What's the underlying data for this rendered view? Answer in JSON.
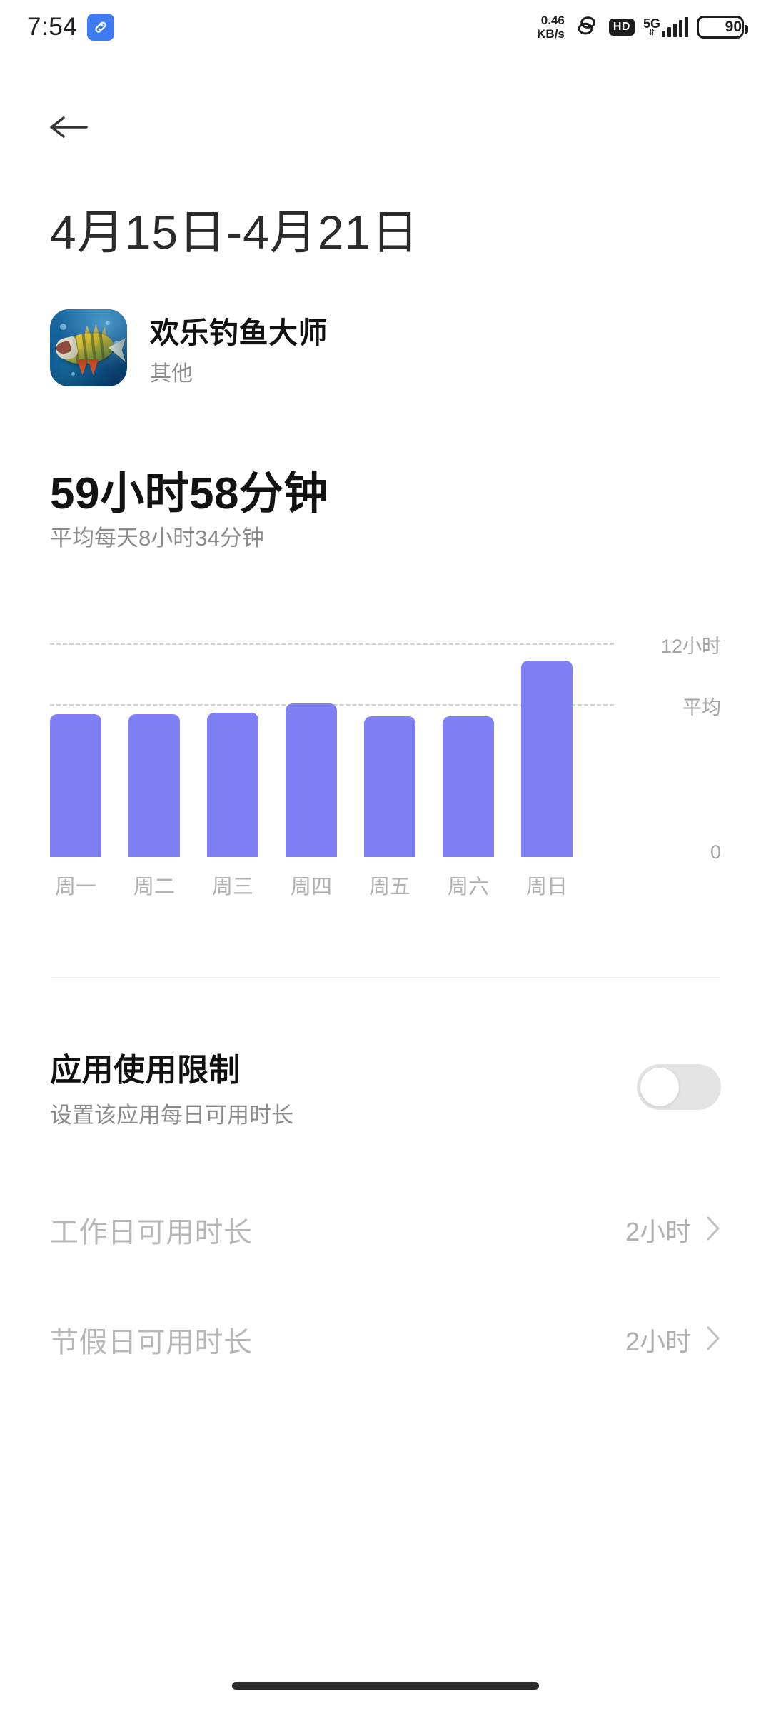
{
  "statusbar": {
    "time": "7:54",
    "app_badge_icon": "link-badge-icon",
    "net_speed_value": "0.46",
    "net_speed_unit": "KB/s",
    "link_icon": "chain-link-icon",
    "hd_label": "HD",
    "network_type": "5G",
    "signal_icon": "signal-bars-icon",
    "battery_level": "90"
  },
  "header": {
    "back_icon": "back-arrow-icon",
    "date_range": "4月15日-4月21日"
  },
  "app": {
    "icon_name": "happy-fishing-master-app-icon",
    "name": "欢乐钓鱼大师",
    "category": "其他"
  },
  "summary": {
    "total_time": "59小时58分钟",
    "average_text": "平均每天8小时34分钟"
  },
  "chart_data": {
    "type": "bar",
    "title": "",
    "xlabel": "",
    "ylabel": "",
    "categories": [
      "周一",
      "周二",
      "周三",
      "周四",
      "周五",
      "周六",
      "周日"
    ],
    "values": [
      8.0,
      8.0,
      8.1,
      8.6,
      7.9,
      7.9,
      11.0
    ],
    "unit": "小时",
    "ylim": [
      0,
      12
    ],
    "grid": true,
    "gridlines": [
      {
        "value": 12,
        "label": "12小时"
      },
      {
        "value": 8.57,
        "label": "平均"
      }
    ],
    "axis_labels": {
      "top": "12小时",
      "average": "平均",
      "bottom": "0"
    },
    "bar_color": "#8080f5",
    "gridline_color": "#d2d2d2",
    "legend": []
  },
  "limit": {
    "title": "应用使用限制",
    "subtitle": "设置该应用每日可用时长",
    "toggle_state": "off",
    "rows": [
      {
        "label": "工作日可用时长",
        "value": "2小时",
        "chevron_icon": "chevron-right-icon"
      },
      {
        "label": "节假日可用时长",
        "value": "2小时",
        "chevron_icon": "chevron-right-icon"
      }
    ]
  },
  "nav": {
    "home_indicator": "home-indicator"
  }
}
